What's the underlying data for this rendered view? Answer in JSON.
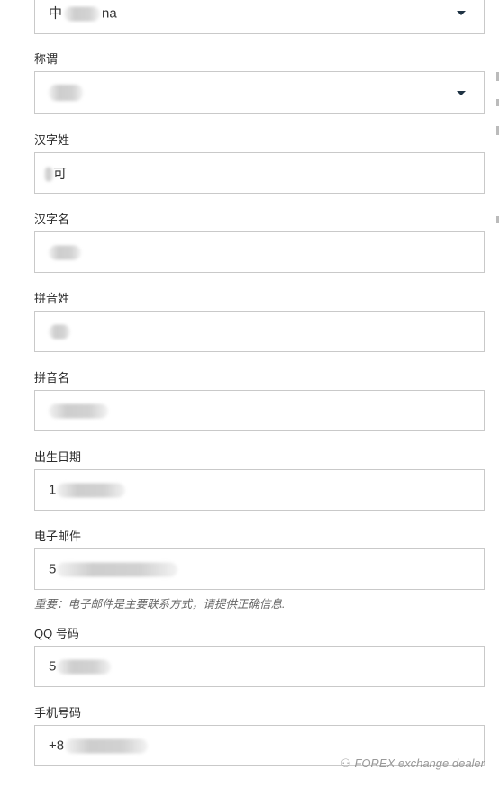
{
  "fields": {
    "nationality": {
      "value_prefix": "中",
      "value_suffix": "na"
    },
    "salutation": {
      "label": "称谓",
      "value": ""
    },
    "chinese_last_name": {
      "label": "汉字姓",
      "value": "可"
    },
    "chinese_first_name": {
      "label": "汉字名",
      "value": ""
    },
    "pinyin_last_name": {
      "label": "拼音姓",
      "value": ""
    },
    "pinyin_first_name": {
      "label": "拼音名",
      "value": ""
    },
    "birth_date": {
      "label": "出生日期",
      "value_prefix": "1"
    },
    "email": {
      "label": "电子邮件",
      "value_prefix": "5",
      "note": "重要：电子邮件是主要联系方式，请提供正确信息."
    },
    "qq": {
      "label": "QQ 号码",
      "value_prefix": "5"
    },
    "mobile": {
      "label": "手机号码",
      "value_prefix": "+8"
    }
  },
  "watermark": {
    "icon": "wechat-icon",
    "text": "FOREX exchange dealer"
  },
  "colors": {
    "border": "#c9c9c9",
    "caret": "#1f3344",
    "label": "#2b2b2b",
    "note": "#666666"
  }
}
